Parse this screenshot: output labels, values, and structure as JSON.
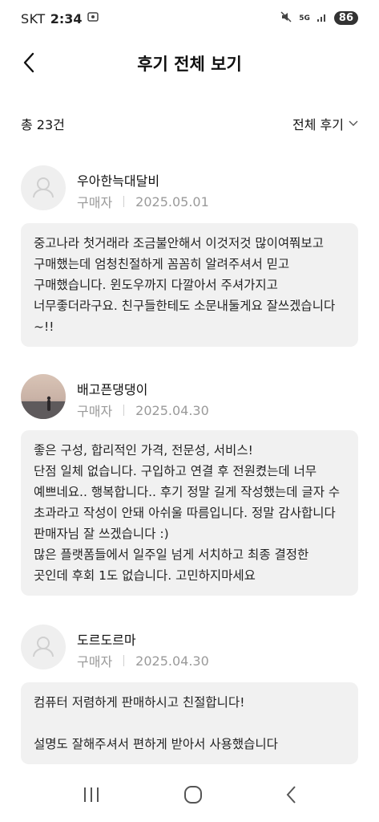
{
  "status": {
    "carrier": "SKT",
    "time": "2:34",
    "battery": "86",
    "network": "5G"
  },
  "header": {
    "title": "후기 전체 보기"
  },
  "summary": {
    "count": "총 23건",
    "filter": "전체 후기"
  },
  "reviews": [
    {
      "name": "우아한늑대달비",
      "role": "구매자",
      "date": "2025.05.01",
      "text": "중고나라 첫거래라 조금불안해서 이것저것 많이여쭤보고 구매했는데 엄청친절하게 꼼꼼히 알려주셔서 믿고 구매했습니다. 윈도우까지 다깔아서 주셔가지고 너무좋더라구요. 친구들한테도 소문내둘게요 잘쓰겠습니다~!!"
    },
    {
      "name": "배고픈댕댕이",
      "role": "구매자",
      "date": "2025.04.30",
      "text": "좋은 구성, 합리적인 가격, 전문성, 서비스!\n단점 일체 없습니다. 구입하고 연결 후 전원켰는데 너무 예쁘네요.. 행복합니다.. 후기 정말 길게 작성했는데 글자 수 초과라고 작성이 안돼 아쉬울 따름입니다. 정말 감사합니다 판매자님 잘 쓰겠습니다 :)\n많은 플랫폼들에서 일주일 넘게 서치하고 최종 결정한 곳인데 후회 1도 없습니다. 고민하지마세요"
    },
    {
      "name": "도르도르마",
      "role": "구매자",
      "date": "2025.04.30",
      "text": "컴퓨터 저렴하게 판매하시고 친절합니다!\n\n설명도 잘해주셔서 편하게 받아서 사용했습니다"
    }
  ],
  "colors": {
    "bubble": "#f1f1f1",
    "meta": "#9a9a9a",
    "avatar_bg": "#efefef"
  }
}
